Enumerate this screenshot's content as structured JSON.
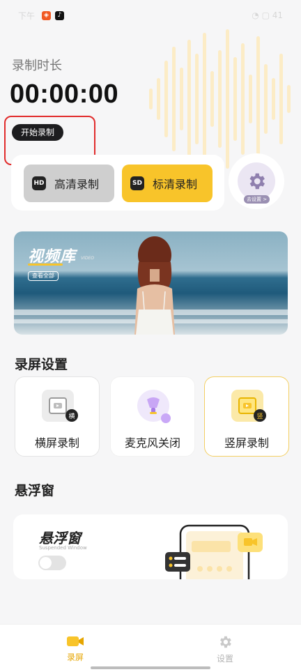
{
  "status_bar": {
    "time": "下午",
    "right": "◔ ▢ 41"
  },
  "header": {
    "label": "录制时长",
    "timer": "00:00:00",
    "start_button": "开始录制"
  },
  "quality": {
    "hd_tag": "HD",
    "hd_label": "高清录制",
    "sd_tag": "SD",
    "sd_label": "标清录制",
    "settings_badge": "去设置 >"
  },
  "banner": {
    "title": "视频库",
    "subtitle": "VIDEO",
    "view_all": "查看全部"
  },
  "record_settings": {
    "title": "录屏设置",
    "tiles": [
      {
        "label": "横屏录制",
        "badge": "横"
      },
      {
        "label": "麦克风关闭"
      },
      {
        "label": "竖屏录制",
        "badge": "竖"
      }
    ]
  },
  "floating_window": {
    "section_title": "悬浮窗",
    "card_title": "悬浮窗",
    "card_subtitle": "Suspended Window",
    "toggle_on": false
  },
  "bottom_nav": {
    "record": "录屏",
    "settings": "设置"
  },
  "colors": {
    "accent": "#f8c42a",
    "annotation": "#e12b2b"
  }
}
